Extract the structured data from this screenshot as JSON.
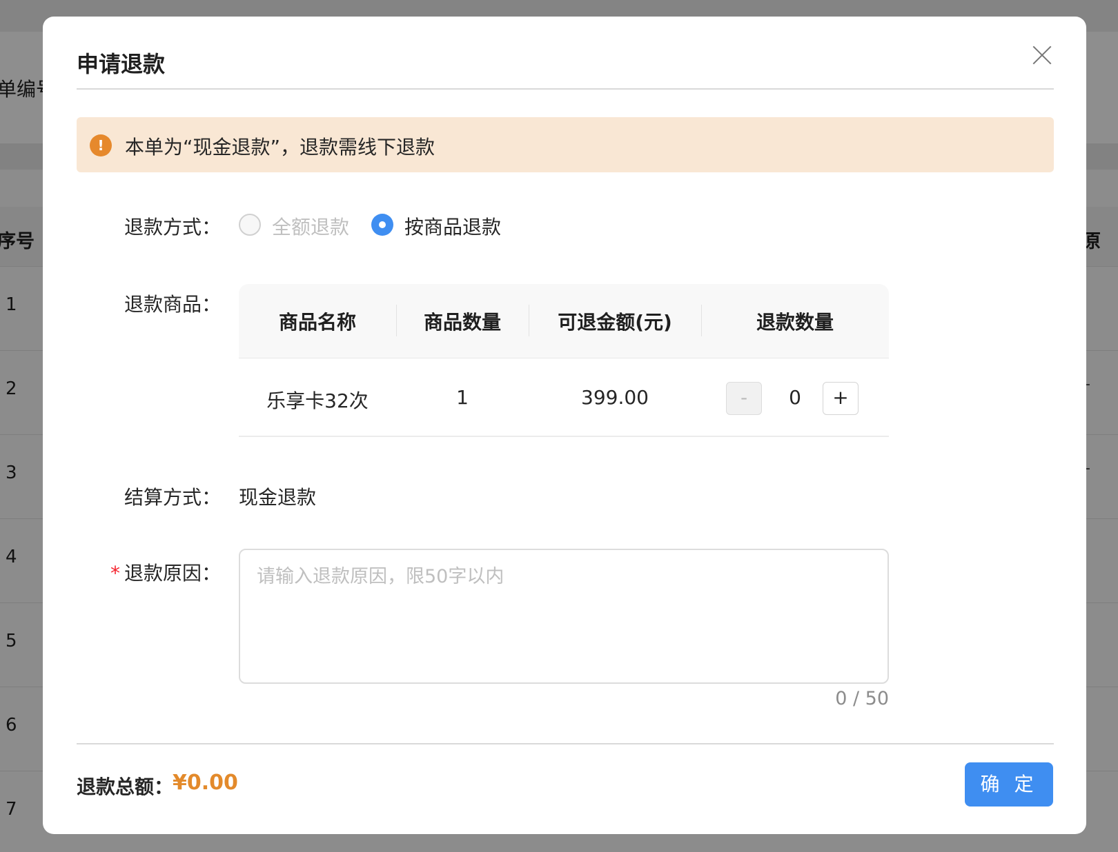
{
  "background": {
    "filter_label": "单编号",
    "table_header": {
      "seq": "序号",
      "right": "原"
    },
    "rows": [
      "1",
      "2",
      "3",
      "4",
      "5",
      "6",
      "7"
    ],
    "row_dash": "-"
  },
  "modal": {
    "title": "申请退款",
    "alert_text": "本单为“现金退款”，退款需线下退款",
    "refund_method": {
      "label": "退款方式：",
      "options": [
        {
          "label": "全额退款",
          "selected": false,
          "disabled": true
        },
        {
          "label": "按商品退款",
          "selected": true,
          "disabled": false
        }
      ]
    },
    "refund_goods": {
      "label": "退款商品：",
      "columns": [
        "商品名称",
        "商品数量",
        "可退金额(元)",
        "退款数量"
      ],
      "rows": [
        {
          "name": "乐享卡32次",
          "quantity": "1",
          "amount": "399.00",
          "refund_qty": "0"
        }
      ],
      "minus": "-",
      "plus": "+"
    },
    "settlement": {
      "label": "结算方式：",
      "value": "现金退款"
    },
    "reason": {
      "required_mark": "*",
      "label": "退款原因：",
      "placeholder": "请输入退款原因，限50字以内",
      "counter": "0 / 50"
    },
    "footer": {
      "total_label": "退款总额：",
      "total_value": "¥0.00",
      "confirm": "确 定"
    }
  },
  "colors": {
    "accent": "#3f8ef1",
    "warning": "#e6892c",
    "alert_bg": "#f9e7d4",
    "total": "#e38a2b",
    "required": "#f5222d"
  },
  "icons": {
    "alert": "exclamation-circle-icon",
    "close": "close-icon"
  }
}
